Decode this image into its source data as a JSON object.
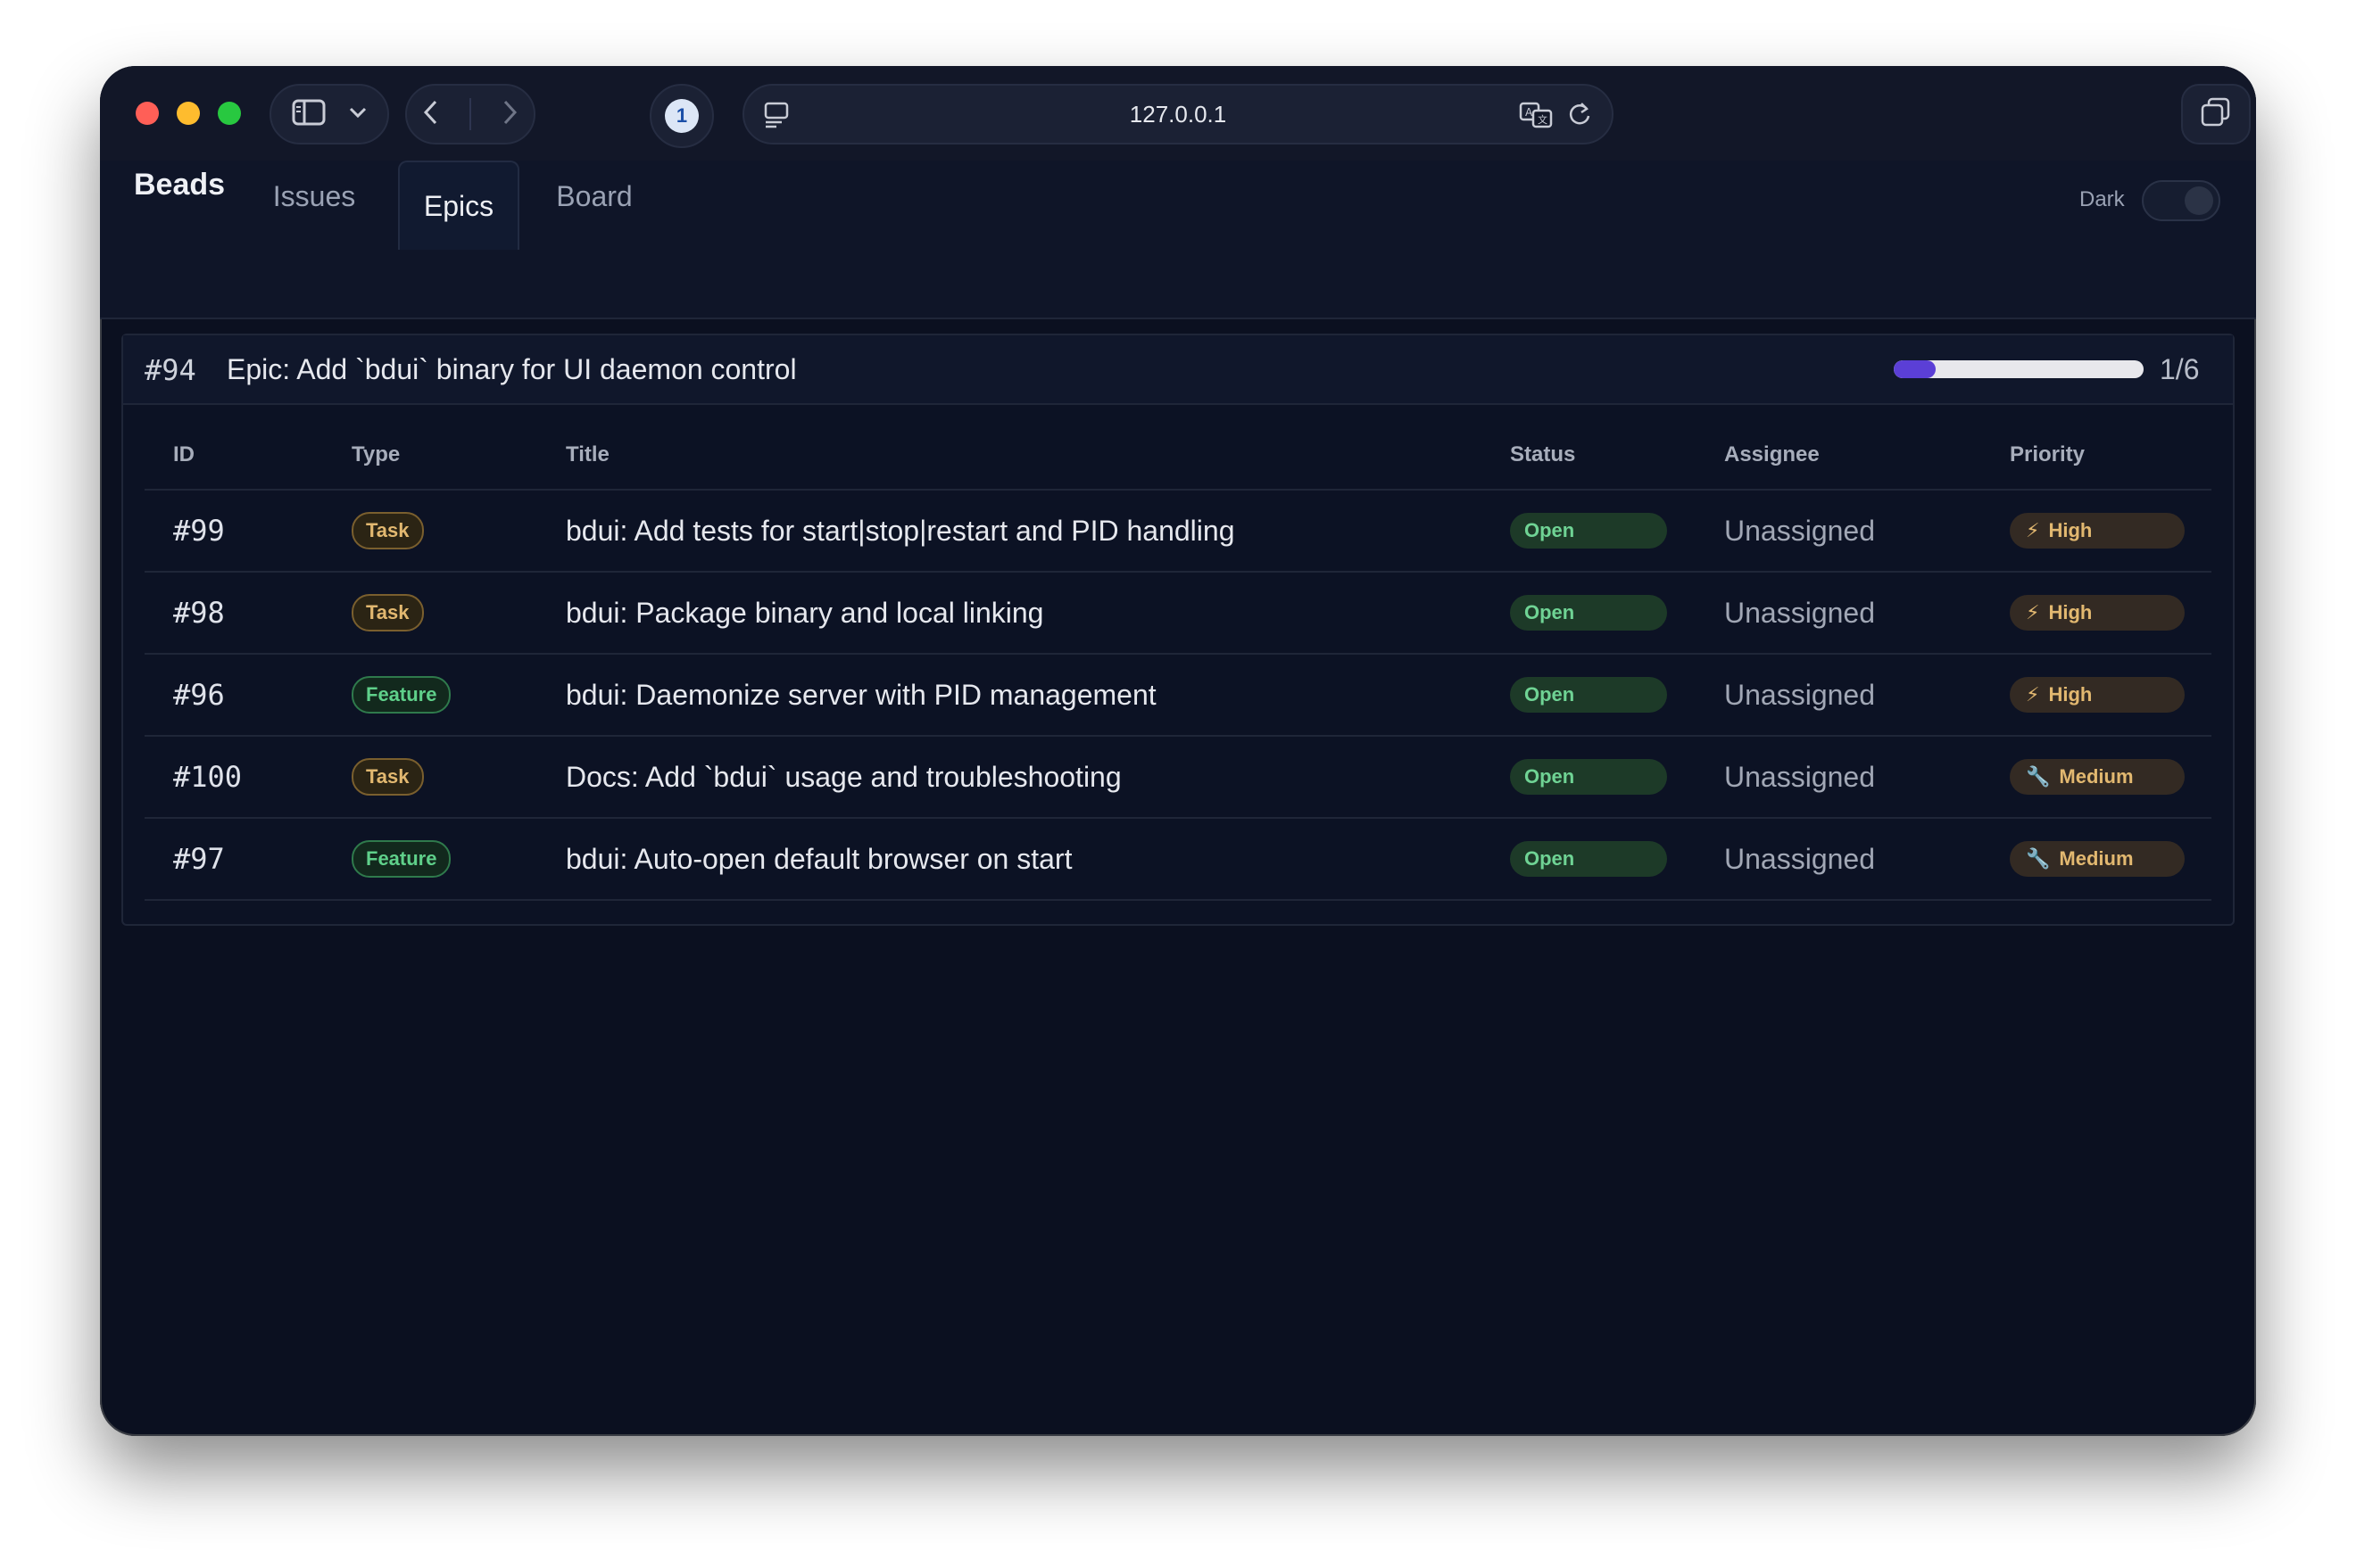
{
  "browser": {
    "url": "127.0.0.1",
    "ext_icon_letter": "1"
  },
  "app": {
    "title": "Beads",
    "tabs": [
      {
        "label": "Issues",
        "active": false
      },
      {
        "label": "Epics",
        "active": true
      },
      {
        "label": "Board",
        "active": false
      }
    ],
    "theme_toggle": {
      "label": "Dark",
      "on": false
    }
  },
  "epic": {
    "id": "#94",
    "title": "Epic: Add `bdui` binary for UI daemon control",
    "progress_text": "1/6",
    "progress_fraction": 0.167,
    "columns": [
      "ID",
      "Type",
      "Title",
      "Status",
      "Assignee",
      "Priority"
    ],
    "rows": [
      {
        "id": "#99",
        "type": "Task",
        "title": "bdui: Add tests for start|stop|restart and PID handling",
        "status": "Open",
        "assignee": "Unassigned",
        "priority": "High",
        "priority_icon": "⚡"
      },
      {
        "id": "#98",
        "type": "Task",
        "title": "bdui: Package binary and local linking",
        "status": "Open",
        "assignee": "Unassigned",
        "priority": "High",
        "priority_icon": "⚡"
      },
      {
        "id": "#96",
        "type": "Feature",
        "title": "bdui: Daemonize server with PID management",
        "status": "Open",
        "assignee": "Unassigned",
        "priority": "High",
        "priority_icon": "⚡"
      },
      {
        "id": "#100",
        "type": "Task",
        "title": "Docs: Add `bdui` usage and troubleshooting",
        "status": "Open",
        "assignee": "Unassigned",
        "priority": "Medium",
        "priority_icon": "🔧"
      },
      {
        "id": "#97",
        "type": "Feature",
        "title": "bdui: Auto-open default browser on start",
        "status": "Open",
        "assignee": "Unassigned",
        "priority": "Medium",
        "priority_icon": "🔧"
      }
    ]
  },
  "colors": {
    "background": "#0b1020",
    "accent": "#5b3fd6",
    "status_open": "#6fd394",
    "priority": "#e2b870"
  }
}
